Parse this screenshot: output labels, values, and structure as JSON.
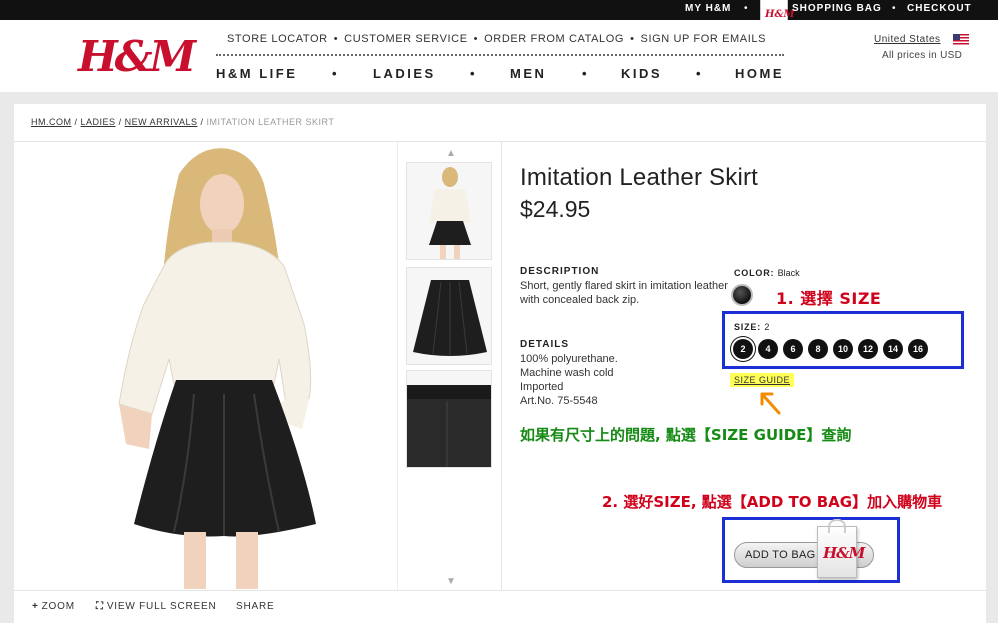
{
  "topbar": {
    "my_hm": "MY H&M",
    "bullet": "•",
    "bag_logo": "H&M",
    "shopping_bag": "SHOPPING BAG",
    "checkout": "CHECKOUT"
  },
  "header": {
    "logo": "H&M",
    "links": [
      "STORE LOCATOR",
      "CUSTOMER SERVICE",
      "ORDER FROM CATALOG",
      "SIGN UP FOR EMAILS"
    ],
    "link_sep": "•",
    "nav": [
      "H&M LIFE",
      "LADIES",
      "MEN",
      "KIDS",
      "HOME"
    ],
    "country": "United States",
    "prices_note": "All prices in USD"
  },
  "breadcrumb": {
    "items": [
      "HM.COM",
      "LADIES",
      "NEW ARRIVALS"
    ],
    "separator": "/",
    "current": "IMITATION LEATHER SKIRT"
  },
  "product": {
    "title": "Imitation Leather Skirt",
    "price": "$24.95",
    "description_label": "DESCRIPTION",
    "description": "Short, gently flared skirt in imitation leather with concealed back zip.",
    "details_label": "DETAILS",
    "details": [
      "100% polyurethane.",
      "Machine wash cold",
      "Imported",
      "Art.No. 75-5548"
    ],
    "color_label": "COLOR:",
    "color_value": "Black",
    "size_label": "SIZE:",
    "size_value": "2",
    "sizes": [
      "2",
      "4",
      "6",
      "8",
      "10",
      "12",
      "14",
      "16"
    ],
    "selected_size": "2",
    "size_guide": "SIZE GUIDE",
    "add_to_bag": "ADD TO BAG",
    "bag_logo": "H&M"
  },
  "annotations": {
    "step1": "1. 選擇 SIZE",
    "size_help": "如果有尺寸上的問題, 點選【SIZE GUIDE】查詢",
    "step2": "2. 選好SIZE, 點選【ADD TO BAG】加入購物車"
  },
  "tools": {
    "zoom": "ZOOM",
    "full_screen": "VIEW FULL SCREEN",
    "share": "SHARE"
  },
  "colors": {
    "brand_red": "#c8102e",
    "annotation_blue": "#1c2fd6",
    "annotation_red": "#d0021b",
    "annotation_green": "#158a14",
    "highlight_yellow": "#ffff55"
  }
}
